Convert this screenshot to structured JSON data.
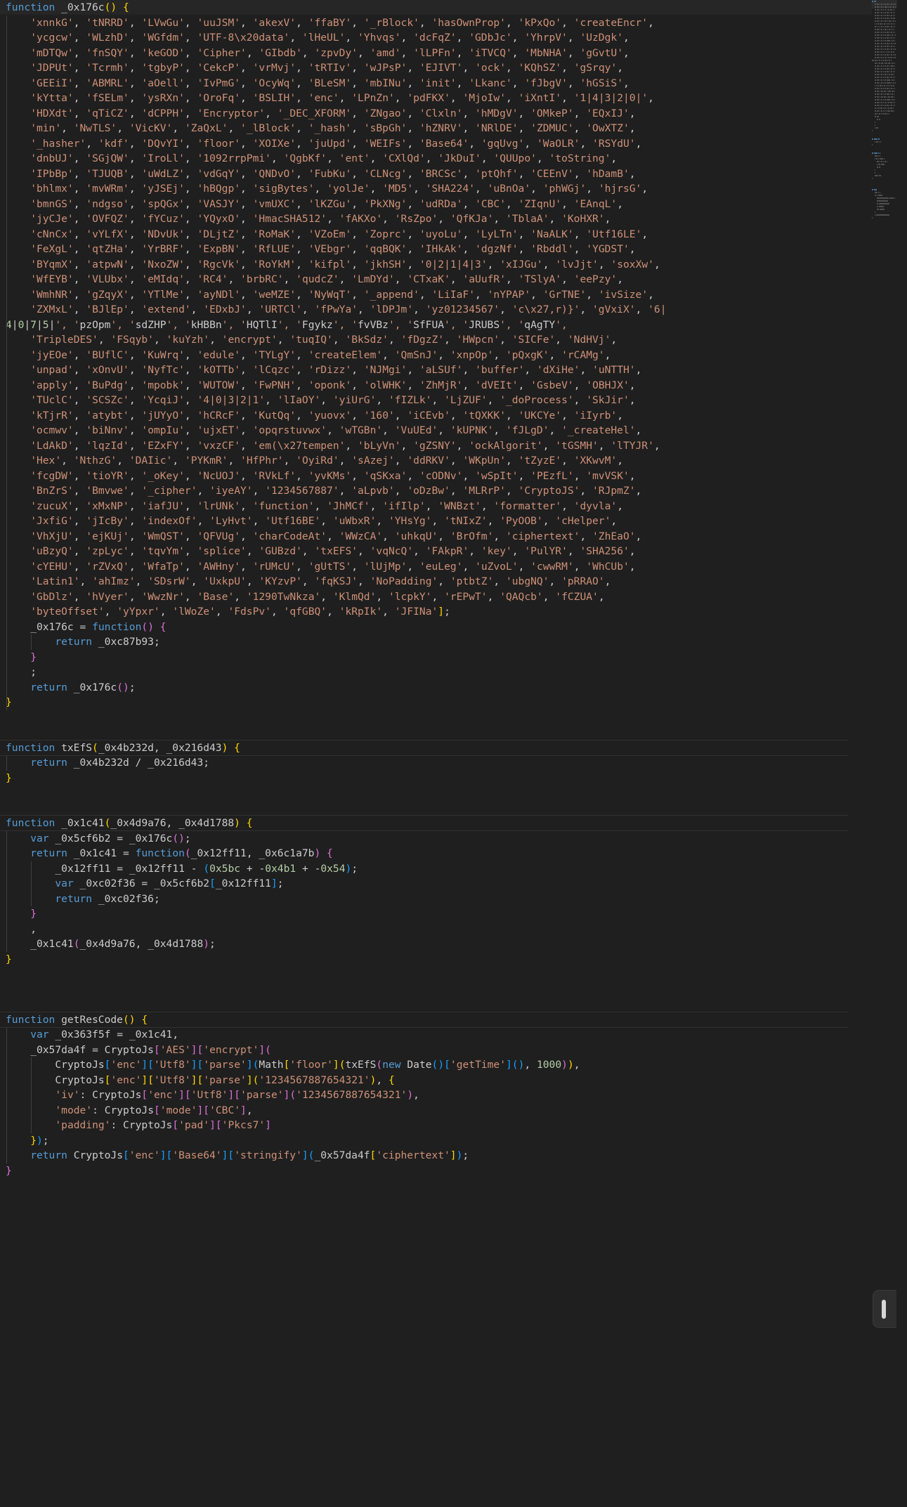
{
  "editor": {
    "language": "javascript",
    "theme": "Dark Modern",
    "background": "#1f1f1f",
    "foreground": "#cccccc",
    "sticky_header_background": "#262626",
    "colors": {
      "keyword": "#569cd6",
      "string": "#ce9178",
      "number": "#b5cea8",
      "identifier": "#cccccc",
      "bracket_level_1": "#ffd700",
      "bracket_level_2": "#da70d6",
      "bracket_level_3": "#179fff",
      "indent_guide": "#404040",
      "separator_rule": "#313131",
      "minimap_text": "#6e6e6e"
    }
  },
  "sticky_header": {
    "text": "function _0x176c() {"
  },
  "widgets": {
    "minimap": {
      "name": "minimap",
      "visible": true
    },
    "scrollbar": {
      "name": "vertical-scrollbar",
      "visible": true
    },
    "slider_handle": {
      "name": "slider-handle",
      "visible": true
    }
  },
  "code": {
    "string_array_lines": [
      "    'xnnkG', 'tNRRD', 'LVwGu', 'uuJSM', 'akexV', 'ffaBY', '_rBlock', 'hasOwnProp', 'kPxQo', 'createEncr',",
      "    'ycgcw', 'WLzhD', 'WGfdm', 'UTF-8\\x20data', 'lHeUL', 'Yhvqs', 'dcFqZ', 'GDbJc', 'YhrpV', 'UzDgk',",
      "    'mDTQw', 'fnSQY', 'keGOD', 'Cipher', 'GIbdb', 'zpvDy', 'amd', 'lLPFn', 'iTVCQ', 'MbNHA', 'gGvtU',",
      "    'JDPUt', 'Tcrmh', 'tgbyP', 'CekcP', 'vrMvj', 'tRTIv', 'wJPsP', 'EJIVT', 'ock', 'KQhSZ', 'gSrqy',",
      "    'GEEiI', 'ABMRL', 'aOell', 'IvPmG', 'OcyWq', 'BLeSM', 'mbINu', 'init', 'Lkanc', 'fJbgV', 'hGSiS',",
      "    'kYtta', 'fSELm', 'ysRXn', 'OroFq', 'BSLIH', 'enc', 'LPnZn', 'pdFKX', 'MjoIw', 'iXntI', '1|4|3|2|0|',",
      "    'HDXdt', 'qTiCZ', 'dCPPH', 'Encryptor', '_DEC_XFORM', 'ZNgao', 'Clxln', 'hMDgV', 'OMkeP', 'EQxIJ',",
      "    'min', 'NwTLS', 'VicKV', 'ZaQxL', '_lBlock', '_hash', 'sBpGh', 'hZNRV', 'NRlDE', 'ZDMUC', 'OwXTZ',",
      "    '_hasher', 'kdf', 'DQvYI', 'floor', 'XOIXe', 'juUpd', 'WEIFs', 'Base64', 'gqUvg', 'WaOLR', 'RSYdU',",
      "    'dnbUJ', 'SGjQW', 'IroLl', '1092rrpPmi', 'QgbKf', 'ent', 'CXlQd', 'JkDuI', 'QUUpo', 'toString',",
      "    'IPbBp', 'TJUQB', 'uWdLZ', 'vdGqY', 'QNDvO', 'FubKu', 'CLNcg', 'BRCSc', 'ptQhf', 'CEEnV', 'hDamB',",
      "    'bhlmx', 'mvWRm', 'yJSEj', 'hBQgp', 'sigBytes', 'yolJe', 'MD5', 'SHA224', 'uBnOa', 'phWGj', 'hjrsG',",
      "    'bmnGS', 'ndgso', 'spQGx', 'VASJY', 'vmUXC', 'lKZGu', 'PkXNg', 'udRDa', 'CBC', 'ZIqnU', 'EAnqL',",
      "    'jyCJe', 'OVFQZ', 'fYCuz', 'YQyxO', 'HmacSHA512', 'fAKXo', 'RsZpo', 'QfKJa', 'TblaA', 'KoHXR',",
      "    'cNnCx', 'vYLfX', 'NDvUk', 'DLjtZ', 'RoMaK', 'VZoEm', 'Zoprc', 'uyoLu', 'LyLTn', 'NaALK', 'Utf16LE',",
      "    'FeXgL', 'qtZHa', 'YrBRF', 'ExpBN', 'RfLUE', 'VEbgr', 'qqBQK', 'IHkAk', 'dgzNf', 'Rbddl', 'YGDST',",
      "    'BYqmX', 'atpwN', 'NxoZW', 'RgcVk', 'RoYkM', 'kifpl', 'jkhSH', '0|2|1|4|3', 'xIJGu', 'lvJjt', 'soxXw',",
      "    'WfEYB', 'VLUbx', 'eMIdq', 'RC4', 'brbRC', 'qudcZ', 'LmDYd', 'CTxaK', 'aUufR', 'TSlyA', 'eePzy',",
      "    'WmhNR', 'gZqyX', 'YTlMe', 'ayNDl', 'weMZE', 'NyWqT', '_append', 'LiIaF', 'nYPAP', 'GrTNE', 'ivSize',",
      "    'ZXMxL', 'BJlEp', 'extend', 'EDxbJ', 'URTCl', 'fPwYa', 'lDPJm', 'yz01234567', 'c\\x27,r)}', 'gVxiX', '6|",
      "4|0|7|5|', 'pzOpm', 'sdZHP', 'kHBBn', 'HQTlI', 'Fgykz', 'fvVBz', 'SfFUA', 'JRUBS', 'qAgTY',",
      "    'TripleDES', 'FSqyb', 'kuYzh', 'encrypt', 'tuqIQ', 'BkSdz', 'fDgzZ', 'HWpcn', 'SICFe', 'NdHVj',",
      "    'jyEOe', 'BUflC', 'KuWrq', 'edule', 'TYLgY', 'createElem', 'QmSnJ', 'xnpOp', 'pQxgK', 'rCAMg',",
      "    'unpad', 'xOnvU', 'NyfTc', 'kOTTb', 'lCqzc', 'rDizz', 'NJMgi', 'aLSUf', 'buffer', 'dXiHe', 'uNTTH',",
      "    'apply', 'BuPdg', 'mpobk', 'WUTOW', 'FwPNH', 'oponk', 'olWHK', 'ZhMjR', 'dVEIt', 'GsbeV', 'OBHJX',",
      "    'TUclC', 'SCSZc', 'YcqiJ', '4|0|3|2|1', 'lIaOY', 'yiUrG', 'fIZLk', 'LjZUF', '_doProcess', 'SkJir',",
      "    'kTjrR', 'atybt', 'jUYyO', 'hCRcF', 'KutQq', 'yuovx', '160', 'iCEvb', 'tQXKK', 'UKCYe', 'iIyrb',",
      "    'ocmwv', 'biNnv', 'ompIu', 'ujxET', 'opqrstuvwx', 'wTGBn', 'VuUEd', 'kUPNK', 'fJLgD', '_createHel',",
      "    'LdAkD', 'lqzId', 'EZxFY', 'vxzCF', 'em(\\x27tempen', 'bLyVn', 'gZSNY', 'ockAlgorit', 'tGSMH', 'lTYJR',",
      "    'Hex', 'NthzG', 'DAIic', 'PYKmR', 'HfPhr', 'OyiRd', 'sAzej', 'ddRKV', 'WKpUn', 'tZyzE', 'XKwvM',",
      "    'fcgDW', 'tioYR', '_oKey', 'NcUOJ', 'RVkLf', 'yvKMs', 'qSKxa', 'cODNv', 'wSpIt', 'PEzfL', 'mvVSK',",
      "    'BnZrS', 'Bmvwe', '_cipher', 'iyeAY', '1234567887', 'aLpvb', 'oDzBw', 'MLRrP', 'CryptoJS', 'RJpmZ',",
      "    'zucuX', 'xMxNP', 'iafJU', 'lrUNk', 'function', 'JhMCf', 'ifIlp', 'WNBzt', 'formatter', 'dyvla',",
      "    'JxfiG', 'jIcBy', 'indexOf', 'LyHvt', 'Utf16BE', 'uWbxR', 'YHsYg', 'tNIxZ', 'PyOOB', 'cHelper',",
      "    'VhXjU', 'ejKUj', 'WmQST', 'QFVUg', 'charCodeAt', 'WWzCA', 'uhkqU', 'BrOfm', 'ciphertext', 'ZhEaO',",
      "    'uBzyQ', 'zpLyc', 'tqvYm', 'splice', 'GUBzd', 'txEFS', 'vqNcQ', 'FAkpR', 'key', 'PulYR', 'SHA256',",
      "    'cYEHU', 'rZVxQ', 'WfaTp', 'AWHny', 'rUMcU', 'gUtTS', 'lUjMp', 'euLeg', 'uZvoL', 'cwwRM', 'WhCUb',",
      "    'Latin1', 'ahImz', 'SDsrW', 'UxkpU', 'KYzvP', 'fqKSJ', 'NoPadding', 'ptbtZ', 'ubgNQ', 'pRRAO',",
      "    'GbDlz', 'hVyer', 'WwzNr', 'Base', '1290TwNkza', 'KlmQd', 'lcpkY', 'rEPwT', 'QAQcb', 'fCZUA',",
      "    'byteOffset', 'yYpxr', 'lWoZe', 'FdsPv', 'qfGBQ', 'kRpIk', 'JFINa'];"
    ],
    "block_176c_tail": [
      "    _0x176c = function() {",
      "        return _0xc87b93;",
      "    }",
      "    ;",
      "    return _0x176c();",
      "}"
    ],
    "block_txEfS": [
      "function txEfS(_0x4b232d, _0x216d43) {",
      "    return _0x4b232d / _0x216d43;",
      "}"
    ],
    "block_0x1c41": [
      "function _0x1c41(_0x4d9a76, _0x4d1788) {",
      "    var _0x5cf6b2 = _0x176c();",
      "    return _0x1c41 = function(_0x12ff11, _0x6c1a7b) {",
      "        _0x12ff11 = _0x12ff11 - (0x5bc + -0x4b1 + -0x54);",
      "        var _0xc02f36 = _0x5cf6b2[_0x12ff11];",
      "        return _0xc02f36;",
      "    }",
      "    ,",
      "    _0x1c41(_0x4d9a76, _0x4d1788);",
      "}"
    ],
    "block_getResCode": [
      "function getResCode() {",
      "    var _0x363f5f = _0x1c41,",
      "    _0x57da4f = CryptoJs['AES']['encrypt'](",
      "        CryptoJs['enc']['Utf8']['parse'](Math['floor'](txEfS(new Date()['getTime'](), 1000)),",
      "        CryptoJs['enc']['Utf8']['parse']('1234567887654321'), {",
      "        'iv': CryptoJs['enc']['Utf8']['parse']('1234567887654321'),",
      "        'mode': CryptoJs['mode']['CBC'],",
      "        'padding': CryptoJs['pad']['Pkcs7']",
      "    });",
      "    return CryptoJs['enc']['Base64']['stringify'](_0x57da4f['ciphertext']);",
      "}"
    ]
  }
}
